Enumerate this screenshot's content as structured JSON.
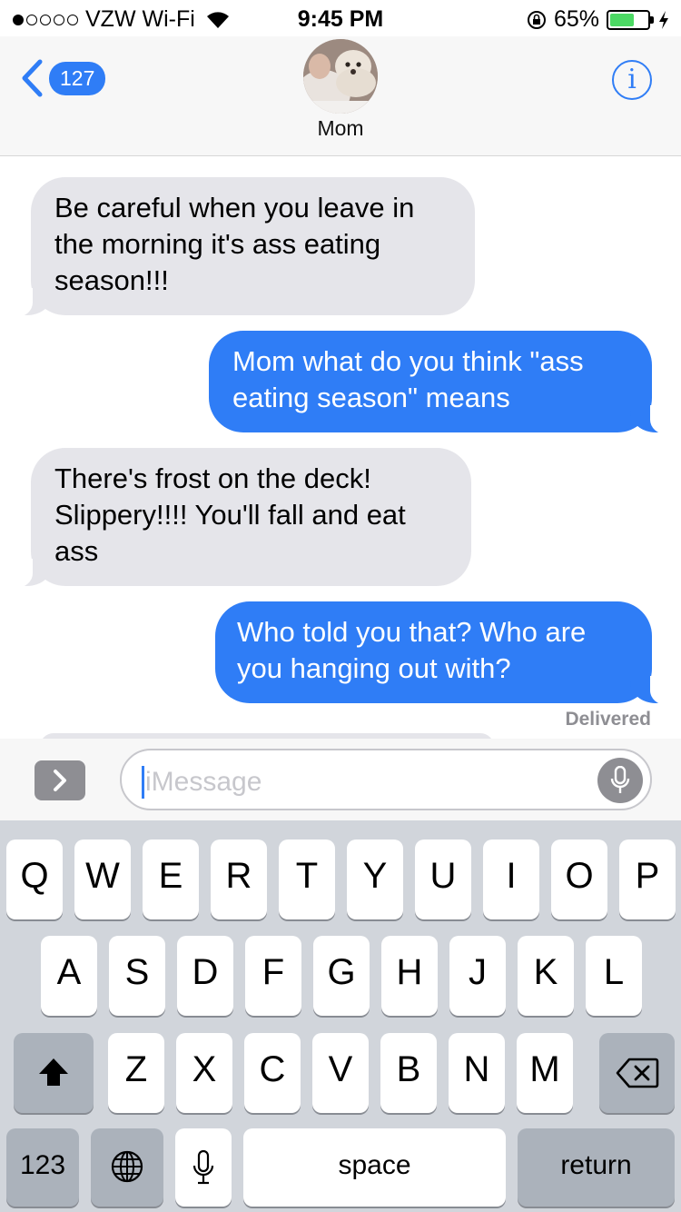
{
  "status_bar": {
    "carrier": "VZW Wi-Fi",
    "time": "9:45 PM",
    "battery": "65%",
    "battery_level": 0.65,
    "signal_bars_filled": 1,
    "signal_bars_total": 5
  },
  "header": {
    "back_count": "127",
    "contact_name": "Mom",
    "info_label": "i"
  },
  "messages": [
    {
      "direction": "incoming",
      "text": "Be careful when you leave in the morning it's ass eating season!!!"
    },
    {
      "direction": "outgoing",
      "text": "Mom what do you think \"ass eating season\" means"
    },
    {
      "direction": "incoming",
      "text": "There's frost on the deck! Slippery!!!! You'll fall and eat ass"
    },
    {
      "direction": "outgoing",
      "text": "Who told you that? Who are you hanging out with?"
    }
  ],
  "delivered_label": "Delivered",
  "input": {
    "placeholder": "iMessage",
    "value": ""
  },
  "keyboard": {
    "row1": [
      "Q",
      "W",
      "E",
      "R",
      "T",
      "Y",
      "U",
      "I",
      "O",
      "P"
    ],
    "row2": [
      "A",
      "S",
      "D",
      "F",
      "G",
      "H",
      "J",
      "K",
      "L"
    ],
    "row3": [
      "Z",
      "X",
      "C",
      "V",
      "B",
      "N",
      "M"
    ],
    "numbers_label": "123",
    "space_label": "space",
    "return_label": "return"
  },
  "colors": {
    "accent": "#2f7df6",
    "incoming_bubble": "#e5e5ea",
    "keyboard_bg": "#d1d5db"
  },
  "icons": [
    "wifi-icon",
    "orientation-lock-icon",
    "battery-icon",
    "charging-bolt-icon",
    "back-chevron-icon",
    "info-icon",
    "chevron-right-icon",
    "microphone-icon",
    "shift-icon",
    "delete-icon",
    "globe-icon"
  ]
}
